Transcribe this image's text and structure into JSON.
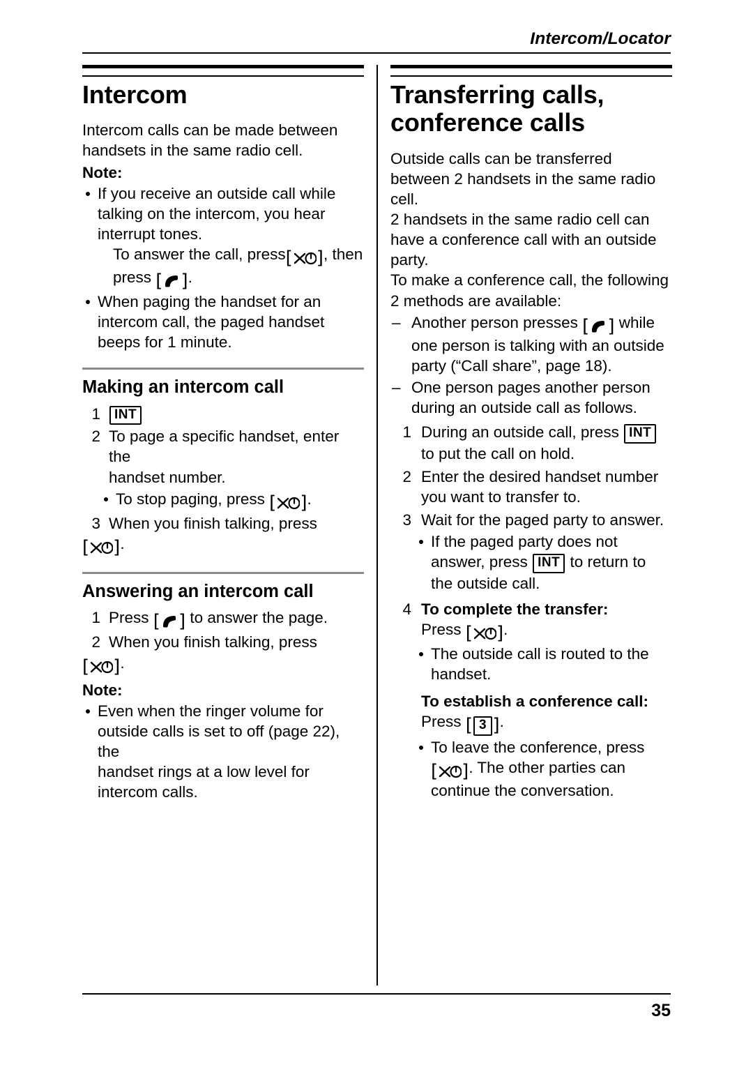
{
  "header": {
    "running_title": "Intercom/Locator"
  },
  "footer": {
    "page_number": "35"
  },
  "left_column": {
    "chapter_title": "Intercom",
    "intro_line1": "Intercom calls can be made between",
    "intro_line2": "handsets in the same radio cell.",
    "note_label": "Note:",
    "note_bullet_1_line1": "If you receive an outside call while",
    "note_bullet_1_line2": "talking on the intercom, you hear",
    "note_bullet_1_line3": "interrupt tones.",
    "note_bullet_1_line4_a": "To answer the call, press",
    "note_bullet_1_line4_b": ", then",
    "note_bullet_1_line5_a": "press",
    "note_bullet_1_line5_b": ".",
    "note_bullet_2_line1": "When paging the handset for an",
    "note_bullet_2_line2": "intercom call, the paged handset",
    "note_bullet_2_line3": "beeps for 1 minute.",
    "section_making": "Making an intercom call",
    "making_step1_num": "1",
    "making_step1_key": "INT",
    "making_step2_num": "2",
    "making_step2_line1": "To page a specific handset, enter the",
    "making_step2_line2": "handset number.",
    "making_step2_bullet_a": "To stop paging, press",
    "making_step2_bullet_b": ".",
    "making_step3_num": "3",
    "making_step3_line1": "When you finish talking, press",
    "making_step3_line2_end": ".",
    "section_answering": "Answering an intercom call",
    "answering_step1_num": "1",
    "answering_step1_a": "Press",
    "answering_step1_b": "to answer the page.",
    "answering_step2_num": "2",
    "answering_step2_line1": "When you finish talking, press",
    "answering_step2_line2_end": ".",
    "note2_label": "Note:",
    "note2_bullet_line1": "Even when the ringer volume for",
    "note2_bullet_line2": "outside calls is set to off (page 22), the",
    "note2_bullet_line3": "handset rings at a low level for",
    "note2_bullet_line4": "intercom calls."
  },
  "right_column": {
    "chapter_title_line1": "Transferring calls,",
    "chapter_title_line2": "conference calls",
    "p1_line1": "Outside calls can be transferred",
    "p1_line2": "between 2 handsets in the same radio",
    "p1_line3": "cell.",
    "p2_line1": "2 handsets in the same radio cell can",
    "p2_line2": "have a conference call with an outside",
    "p2_line3": "party.",
    "p3_line1": "To make a conference call, the following",
    "p3_line2": "2 methods are available:",
    "dash1_line1_a": "Another person presses",
    "dash1_line1_b": "while",
    "dash1_line2": "one person is talking with an outside",
    "dash1_line3": "party (“Call share”, page 18).",
    "dash2_line1": "One person pages another person",
    "dash2_line2": "during an outside call as follows.",
    "step1_num": "1",
    "step1_line1_a": "During an outside call, press",
    "step1_key": "INT",
    "step1_line2": "to put the call on hold.",
    "step2_num": "2",
    "step2_line1": "Enter the desired handset number",
    "step2_line2": "you want to transfer to.",
    "step3_num": "3",
    "step3_line1": "Wait for the paged party to answer.",
    "step3_bullet_line1": "If the paged party does not",
    "step3_bullet_line2_a": "answer, press",
    "step3_bullet_key": "INT",
    "step3_bullet_line2_b": "to return to",
    "step3_bullet_line3": "the outside call.",
    "step4_num": "4",
    "step4_heading": "To complete the transfer:",
    "step4_press_a": "Press",
    "step4_press_b": ".",
    "step4_bullet_line1": "The outside call is routed to the",
    "step4_bullet_line2": "handset.",
    "conf_heading": "To establish a conference call:",
    "conf_press_a": "Press",
    "conf_key": "3",
    "conf_press_b": ".",
    "conf_bullet_line1": "To leave the conference, press",
    "conf_bullet_line2_b": ". The other parties can",
    "conf_bullet_line3": "continue the conversation."
  },
  "icons": {
    "power_off_key": "power-off-key-icon",
    "talk_key": "talk-key-icon",
    "int_key": "int-key-icon"
  }
}
